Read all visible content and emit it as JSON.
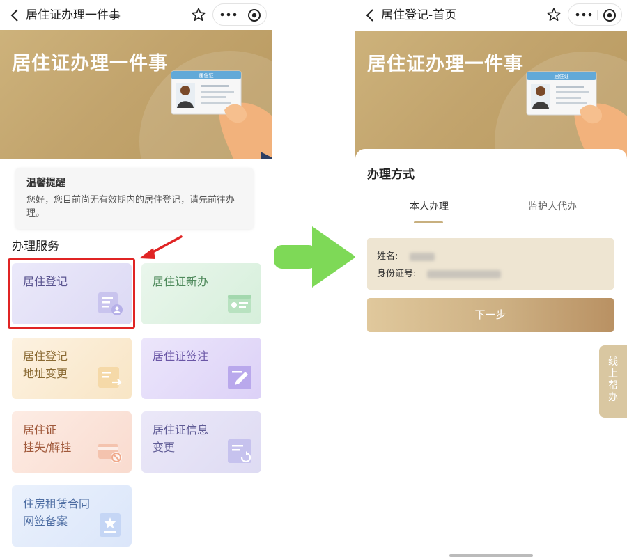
{
  "left": {
    "nav_title": "居住证办理一件事",
    "banner_title": "居住证办理一件事",
    "card_label": "居住证",
    "notice": {
      "title": "温馨提醒",
      "body": "您好，您目前尚无有效期内的居住登记，请先前往办理。"
    },
    "section_title": "办理服务",
    "tiles": [
      {
        "label": "居住登记",
        "icon": "document-user-icon"
      },
      {
        "label": "居住证新办",
        "icon": "id-card-icon"
      },
      {
        "label": "居住登记\n地址变更",
        "icon": "address-change-icon"
      },
      {
        "label": "居住证签注",
        "icon": "pen-edit-icon"
      },
      {
        "label": "居住证\n挂失/解挂",
        "icon": "card-block-icon"
      },
      {
        "label": "居住证信息\n变更",
        "icon": "info-refresh-icon"
      },
      {
        "label": "住房租赁合同\n网签备案",
        "icon": "star-badge-icon"
      }
    ]
  },
  "right": {
    "nav_title": "居住登记-首页",
    "banner_title": "居住证办理一件事",
    "card_label": "居住证",
    "sheet_title": "办理方式",
    "tabs": [
      "本人办理",
      "监护人代办"
    ],
    "active_tab": "本人办理",
    "name_label": "姓名:",
    "id_label": "身份证号:",
    "next_button": "下一步",
    "help_tab": "线上帮办"
  },
  "colors": {
    "gold": "#c2a46d",
    "highlight_red": "#e02424",
    "arrow_green": "#7ed957"
  }
}
